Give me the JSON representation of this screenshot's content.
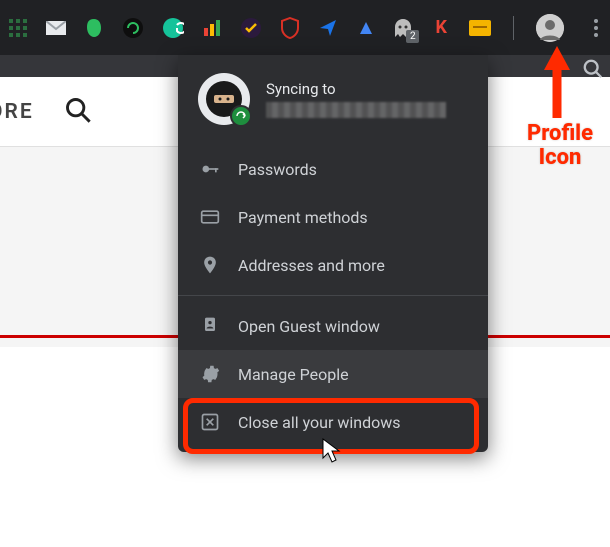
{
  "toolbar": {
    "extensions": [
      {
        "name": "app-launcher-icon",
        "color": "#2b6e3f"
      },
      {
        "name": "gmail-icon",
        "color": "#e8eaed"
      },
      {
        "name": "evernote-icon",
        "color": "#2dbe60"
      },
      {
        "name": "circle-arrow-icon",
        "color": "#1a1a1a"
      },
      {
        "name": "grammarly-icon",
        "color": "#15c39a"
      },
      {
        "name": "analytics-icon",
        "color": "#f9ab00"
      },
      {
        "name": "todoist-icon",
        "color": "#f9ab00"
      },
      {
        "name": "shield-icon",
        "color": "#d93025"
      },
      {
        "name": "send-icon",
        "color": "#1a73e8"
      },
      {
        "name": "speed-icon",
        "color": "#4285f4"
      },
      {
        "name": "ghost-icon",
        "color": "#bdbdbd",
        "badge": "2"
      },
      {
        "name": "k-letter-icon",
        "color": "#ea4335",
        "glyph": "K"
      },
      {
        "name": "card-icon",
        "color": "#f4b400"
      }
    ]
  },
  "pagebar": {
    "partial_tab": "ORE"
  },
  "profile_menu": {
    "sync_label": "Syncing to",
    "items_top": [
      {
        "icon": "key-icon",
        "label": "Passwords"
      },
      {
        "icon": "card-icon",
        "label": "Payment methods"
      },
      {
        "icon": "pin-icon",
        "label": "Addresses and more"
      }
    ],
    "items_bottom": [
      {
        "icon": "guest-icon",
        "label": "Open Guest window"
      },
      {
        "icon": "gear-icon",
        "label": "Manage People"
      },
      {
        "icon": "close-window-icon",
        "label": "Close all your windows"
      }
    ]
  },
  "annotation": {
    "label_line1": "Profile",
    "label_line2": "Icon"
  }
}
